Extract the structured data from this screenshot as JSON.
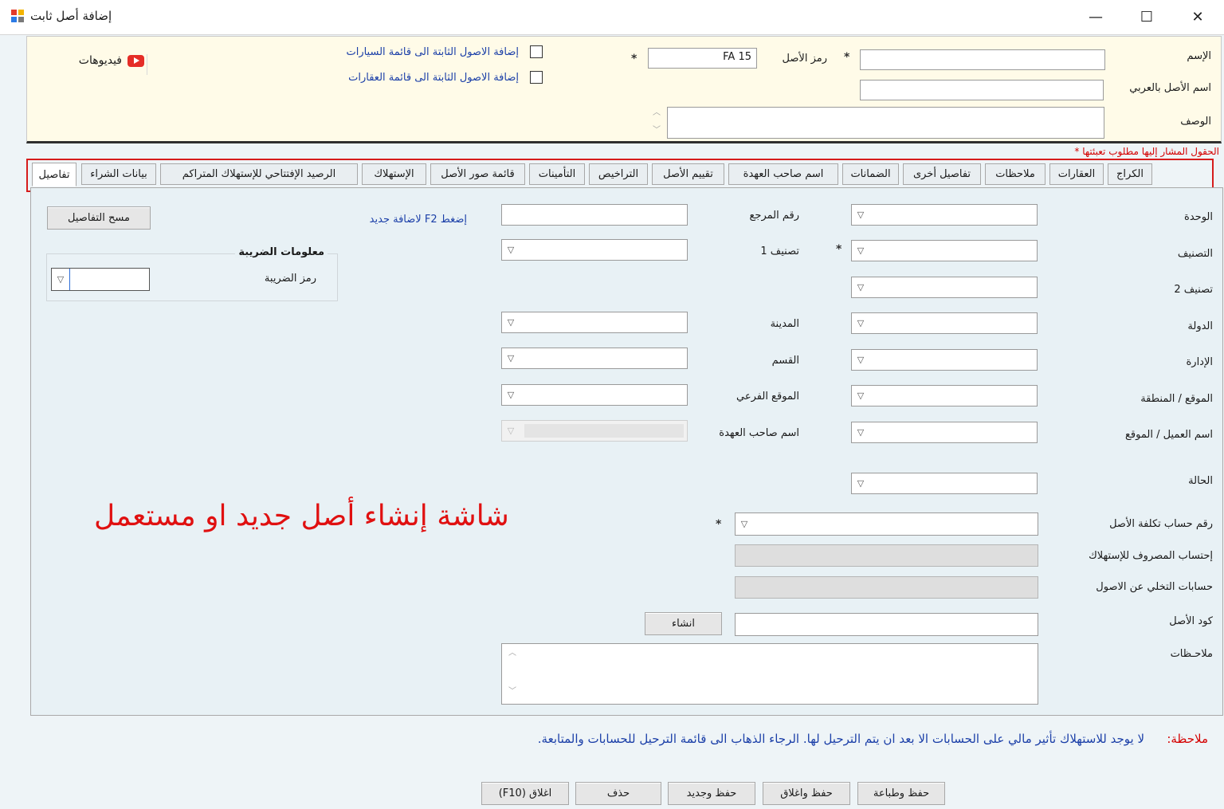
{
  "window": {
    "title": "إضافة أصل ثابت",
    "icon": "app-window-icon",
    "minimize": "—",
    "maximize": "☐",
    "close": "✕"
  },
  "header": {
    "name_label": "الإسم",
    "name_value": "",
    "arabic_name_label": "اسم الأصل بالعربي",
    "arabic_name_value": "",
    "description_label": "الوصف",
    "description_value": "",
    "asset_code_label": "رمز الأصل",
    "asset_code_value": "FA 15",
    "required_mark": "*",
    "add_to_cars_label": "إضافة الاصول الثابتة الى قائمة السيارات",
    "add_to_realestate_label": "إضافة الاصول الثابتة الى قائمة العقارات",
    "videos_label": "فيديوهات",
    "videos_icon": "youtube-icon"
  },
  "required_note": "الحقول المشار إليها مطلوب تعبئتها *",
  "tabs": [
    {
      "label": "تفاصيل",
      "active": true
    },
    {
      "label": "بيانات الشراء"
    },
    {
      "label": "الرصيد الإفتتاحي للإستهلاك المتراكم"
    },
    {
      "label": "الإستهلاك"
    },
    {
      "label": "قائمة صور الأصل"
    },
    {
      "label": "التأمينات"
    },
    {
      "label": "التراخيص"
    },
    {
      "label": "تقييم الأصل"
    },
    {
      "label": "اسم صاحب العهدة"
    },
    {
      "label": "الضمانات"
    },
    {
      "label": "تفاصيل أخرى"
    },
    {
      "label": "ملاحظات"
    },
    {
      "label": "العقارات"
    },
    {
      "label": "الكراج"
    }
  ],
  "details": {
    "unit_label": "الوحدة",
    "classification_label": "التصنيف",
    "classification2_label": "تصنيف 2",
    "country_label": "الدولة",
    "department_label": "الإدارة",
    "location_region_label": "الموقع / المنطقة",
    "client_location_label": "اسم العميل / الموقع",
    "status_label": "الحالة",
    "reference_label": "رقم المرجع",
    "classification1_label": "تصنيف 1",
    "city_label": "المدينة",
    "section_label": "القسم",
    "sublocation_label": "الموقع الفرعي",
    "custodian_label": "اسم صاحب العهدة",
    "f2_hint": "إضغط F2 لاضافة جديد",
    "clear_details": "مسح التفاصيل",
    "tax_group_title": "معلومات الضريبة",
    "tax_code_label": "رمز الضريبة",
    "cost_account_label": "رقم حساب تكلفة الأصل",
    "depreciation_expense_label": "إحتساب المصروف للإستهلاك",
    "disposal_accounts_label": "حسابات التخلي عن الاصول",
    "asset_code_label": "كود الأصل",
    "create_button": "انشاء",
    "notes_label": "ملاحـظات"
  },
  "caption": "شاشة إنشاء أصل جديد او مستعمل",
  "footer": {
    "note_label": "ملاحظة:",
    "note_text": "لا يوجد للاستهلاك تأثير مالي على الحسابات الا بعد ان يتم الترحيل لها. الرجاء الذهاب الى قائمة الترحيل للحسابات والمتابعة.",
    "buttons": {
      "save_print": "حفظ وطباعة",
      "save_close": "حفظ واغلاق",
      "save_new": "حفظ وجديد",
      "delete": "حذف",
      "close": "اغلاق (F10)"
    }
  },
  "icons": {
    "dropdown": "▽",
    "scroll_up": "︿",
    "scroll_down": "﹀"
  }
}
